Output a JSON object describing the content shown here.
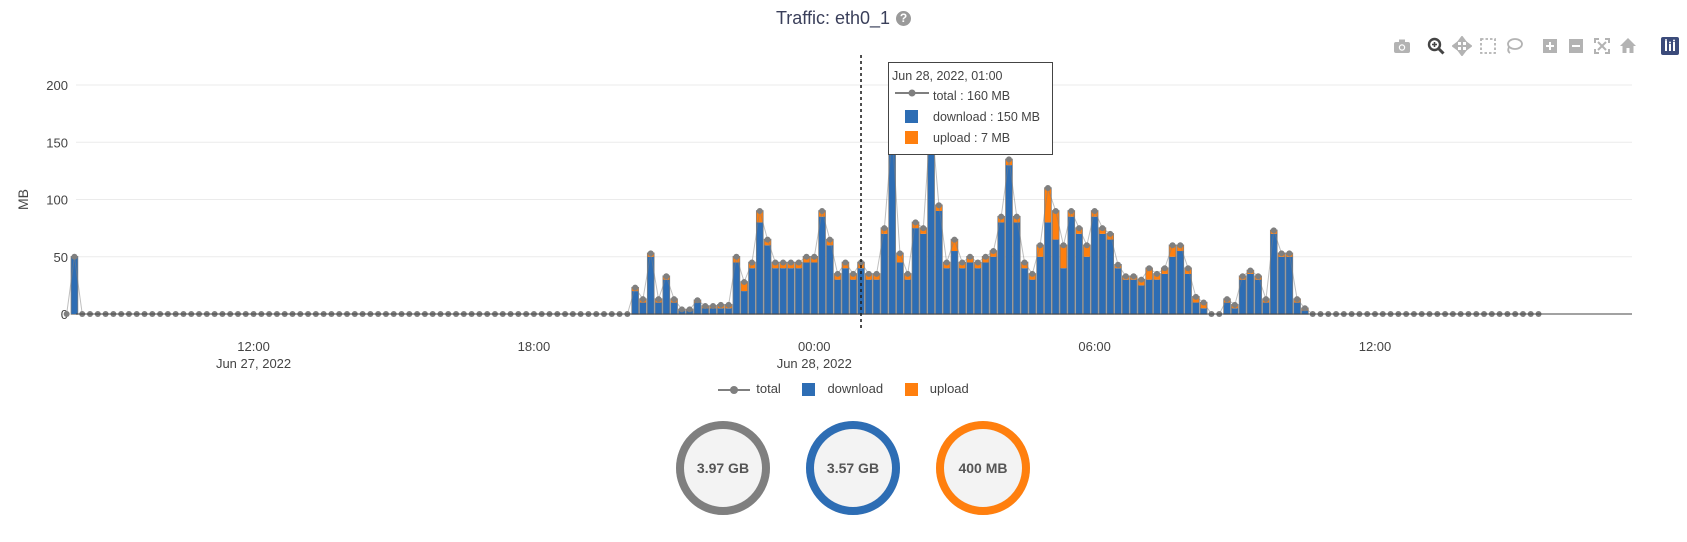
{
  "title": "Traffic: eth0_1",
  "help_icon": "?",
  "modebar": [
    {
      "name": "camera-icon",
      "label": "Download plot as a png"
    },
    {
      "name": "zoom-icon",
      "label": "Zoom"
    },
    {
      "name": "pan-icon",
      "label": "Pan"
    },
    {
      "name": "box-select-icon",
      "label": "Box Select"
    },
    {
      "name": "lasso-select-icon",
      "label": "Lasso Select"
    },
    {
      "name": "zoom-in-icon",
      "label": "Zoom in"
    },
    {
      "name": "zoom-out-icon",
      "label": "Zoom out"
    },
    {
      "name": "autoscale-icon",
      "label": "Autoscale"
    },
    {
      "name": "reset-axes-icon",
      "label": "Reset axes"
    },
    {
      "name": "plotly-logo-icon",
      "label": "Produced with Plotly"
    }
  ],
  "tooltip": {
    "time": "Jun 28, 2022, 01:00",
    "total": "total : 160 MB",
    "download": "download : 150 MB",
    "upload": "upload : 7 MB"
  },
  "legend": [
    {
      "label": "total",
      "kind": "line",
      "color": "#7f7f7f"
    },
    {
      "label": "download",
      "kind": "bar",
      "color": "#2d6db4"
    },
    {
      "label": "upload",
      "kind": "bar",
      "color": "#ff7f0e"
    }
  ],
  "gauges": [
    {
      "label": "3.97 GB",
      "color": "#7f7f7f",
      "fraction": 1.0
    },
    {
      "label": "3.57 GB",
      "color": "#2d6db4",
      "fraction": 1.0
    },
    {
      "label": "400 MB",
      "color": "#ff7f0e",
      "fraction": 1.0
    }
  ],
  "chart_data": {
    "type": "bar",
    "title": "Traffic: eth0_1",
    "ylabel": "MB",
    "xlabel": "",
    "ylim": [
      0,
      200
    ],
    "yticks": [
      0,
      50,
      100,
      150,
      200
    ],
    "xticks": [
      {
        "label": "12:00",
        "sub": "Jun 27, 2022",
        "hour": 12
      },
      {
        "label": "18:00",
        "sub": "",
        "hour": 18
      },
      {
        "label": "00:00",
        "sub": "Jun 28, 2022",
        "hour": 24
      },
      {
        "label": "06:00",
        "sub": "",
        "hour": 30
      },
      {
        "label": "12:00",
        "sub": "",
        "hour": 36
      }
    ],
    "x_range_hours": [
      8.2,
      41.5
    ],
    "start": "Jun 27, 2022, 08:00",
    "interval_minutes": 10,
    "hover_hour": 25.0,
    "bar_mode": "stack",
    "grid": true,
    "legend_position": "bottom",
    "series": [
      {
        "name": "download",
        "color": "#2d6db4",
        "values": [
          0,
          50,
          0,
          0,
          0,
          0,
          0,
          0,
          0,
          0,
          0,
          0,
          0,
          0,
          0,
          0,
          0,
          0,
          0,
          0,
          0,
          0,
          0,
          0,
          0,
          0,
          0,
          0,
          0,
          0,
          0,
          0,
          0,
          0,
          0,
          0,
          0,
          0,
          0,
          0,
          0,
          0,
          0,
          0,
          0,
          0,
          0,
          0,
          0,
          0,
          0,
          0,
          0,
          0,
          0,
          0,
          0,
          0,
          0,
          0,
          0,
          0,
          0,
          0,
          0,
          0,
          0,
          0,
          0,
          0,
          0,
          0,
          0,
          20,
          10,
          50,
          10,
          30,
          10,
          3,
          3,
          10,
          5,
          5,
          5,
          5,
          45,
          20,
          40,
          80,
          60,
          40,
          40,
          40,
          40,
          45,
          45,
          85,
          60,
          30,
          40,
          30,
          40,
          30,
          30,
          70,
          150,
          45,
          30,
          75,
          70,
          170,
          90,
          40,
          55,
          40,
          45,
          40,
          45,
          50,
          80,
          130,
          80,
          40,
          30,
          50,
          80,
          65,
          40,
          85,
          70,
          50,
          85,
          70,
          65,
          40,
          30,
          30,
          25,
          30,
          30,
          35,
          50,
          55,
          35,
          10,
          5,
          0,
          0,
          10,
          5,
          30,
          35,
          30,
          10,
          70,
          50,
          50,
          10,
          3,
          0,
          0,
          0,
          0,
          0,
          0,
          0,
          0,
          0,
          0,
          0,
          0,
          0,
          0,
          0,
          0,
          0,
          0,
          0,
          0,
          0,
          0,
          0,
          0,
          0,
          0,
          0,
          0,
          0,
          0
        ]
      },
      {
        "name": "upload",
        "color": "#ff7f0e",
        "values": [
          0,
          0,
          0,
          0,
          0,
          0,
          0,
          0,
          0,
          0,
          0,
          0,
          0,
          0,
          0,
          0,
          0,
          0,
          0,
          0,
          0,
          0,
          0,
          0,
          0,
          0,
          0,
          0,
          0,
          0,
          0,
          0,
          0,
          0,
          0,
          0,
          0,
          0,
          0,
          0,
          0,
          0,
          0,
          0,
          0,
          0,
          0,
          0,
          0,
          0,
          0,
          0,
          0,
          0,
          0,
          0,
          0,
          0,
          0,
          0,
          0,
          0,
          0,
          0,
          0,
          0,
          0,
          0,
          0,
          0,
          0,
          0,
          0,
          3,
          3,
          3,
          3,
          3,
          3,
          1,
          1,
          2,
          2,
          2,
          3,
          3,
          5,
          8,
          5,
          10,
          5,
          5,
          5,
          5,
          5,
          5,
          5,
          5,
          5,
          5,
          5,
          5,
          5,
          5,
          5,
          5,
          7,
          8,
          5,
          5,
          5,
          5,
          5,
          5,
          10,
          5,
          5,
          5,
          5,
          5,
          5,
          5,
          5,
          5,
          5,
          10,
          30,
          25,
          20,
          5,
          5,
          10,
          5,
          5,
          5,
          3,
          3,
          3,
          5,
          10,
          5,
          5,
          10,
          5,
          5,
          5,
          5,
          0,
          0,
          3,
          3,
          3,
          3,
          3,
          3,
          3,
          3,
          3,
          3,
          2,
          0,
          0,
          0,
          0,
          0,
          0,
          0,
          0,
          0,
          0,
          0,
          0,
          0,
          0,
          0,
          0,
          0,
          0,
          0,
          0,
          0,
          0,
          0,
          0,
          0,
          0,
          0,
          0,
          0,
          0
        ]
      },
      {
        "name": "total",
        "color": "#7f7f7f",
        "type": "line+markers"
      }
    ]
  }
}
